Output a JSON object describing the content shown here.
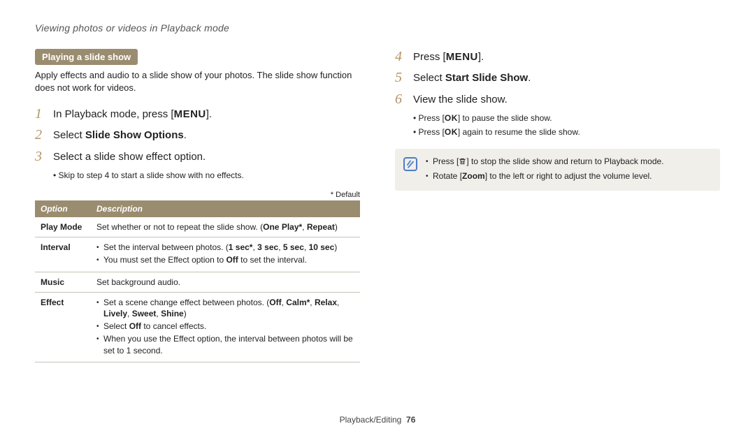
{
  "header": {
    "title": "Viewing photos or videos in Playback mode"
  },
  "col1": {
    "badge": "Playing a slide show",
    "intro": "Apply effects and audio to a slide show of your photos. The slide show function does not work for videos.",
    "step1_pre": "In Playback mode, press [",
    "step1_menu": "MENU",
    "step1_post": "].",
    "step2_pre": "Select ",
    "step2_bold": "Slide Show Options",
    "step2_post": ".",
    "step3": "Select a slide show effect option.",
    "step3_sub": "Skip to step 4 to start a slide show with no effects.",
    "default_note": "* Default",
    "table": {
      "h_option": "Option",
      "h_desc": "Description",
      "rows": {
        "playmode": {
          "label": "Play Mode",
          "pre": "Set whether or not to repeat the slide show. (",
          "bold": "One Play*",
          "mid": ", ",
          "bold2": "Repeat",
          "post": ")"
        },
        "interval": {
          "label": "Interval",
          "b1_pre": "Set the interval between photos. (",
          "b1_bold": "1 sec*",
          "b1_mid": ", ",
          "b1_bold2": "3 sec",
          "b1_mid2": ", ",
          "b1_bold3": "5 sec",
          "b1_mid3": ", ",
          "b1_bold4": "10 sec",
          "b1_post": ")",
          "b2_pre": "You must set the Effect option to ",
          "b2_bold": "Off",
          "b2_post": " to set the interval."
        },
        "music": {
          "label": "Music",
          "text": "Set background audio."
        },
        "effect": {
          "label": "Effect",
          "b1_pre": "Set a scene change effect between photos. (",
          "b1_bold1": "Off",
          "b1_s1": ", ",
          "b1_bold2": "Calm*",
          "b1_s2": ", ",
          "b1_bold3": "Relax",
          "b1_s3": ", ",
          "b1_bold4": "Lively",
          "b1_s4": ", ",
          "b1_bold5": "Sweet",
          "b1_s5": ", ",
          "b1_bold6": "Shine",
          "b1_post": ")",
          "b2_pre": "Select ",
          "b2_bold": "Off",
          "b2_post": " to cancel effects.",
          "b3": "When you use the Effect option, the interval between photos will be set to 1 second."
        }
      }
    }
  },
  "col2": {
    "step4_pre": "Press [",
    "step4_menu": "MENU",
    "step4_post": "].",
    "step5_pre": "Select ",
    "step5_bold": "Start Slide Show",
    "step5_post": ".",
    "step6": "View the slide show.",
    "step6_sub1_pre": "Press [",
    "step6_sub1_ok": "OK",
    "step6_sub1_post": "] to pause the slide show.",
    "step6_sub2_pre": "Press [",
    "step6_sub2_ok": "OK",
    "step6_sub2_post": "] again to resume the slide show.",
    "note": {
      "line1_pre": "Press [",
      "line1_post": "] to stop the slide show and return to Playback mode.",
      "line2_pre": "Rotate [",
      "line2_bold": "Zoom",
      "line2_post": "] to the left or right to adjust the volume level."
    }
  },
  "footer": {
    "section": "Playback/Editing",
    "page": "76"
  }
}
